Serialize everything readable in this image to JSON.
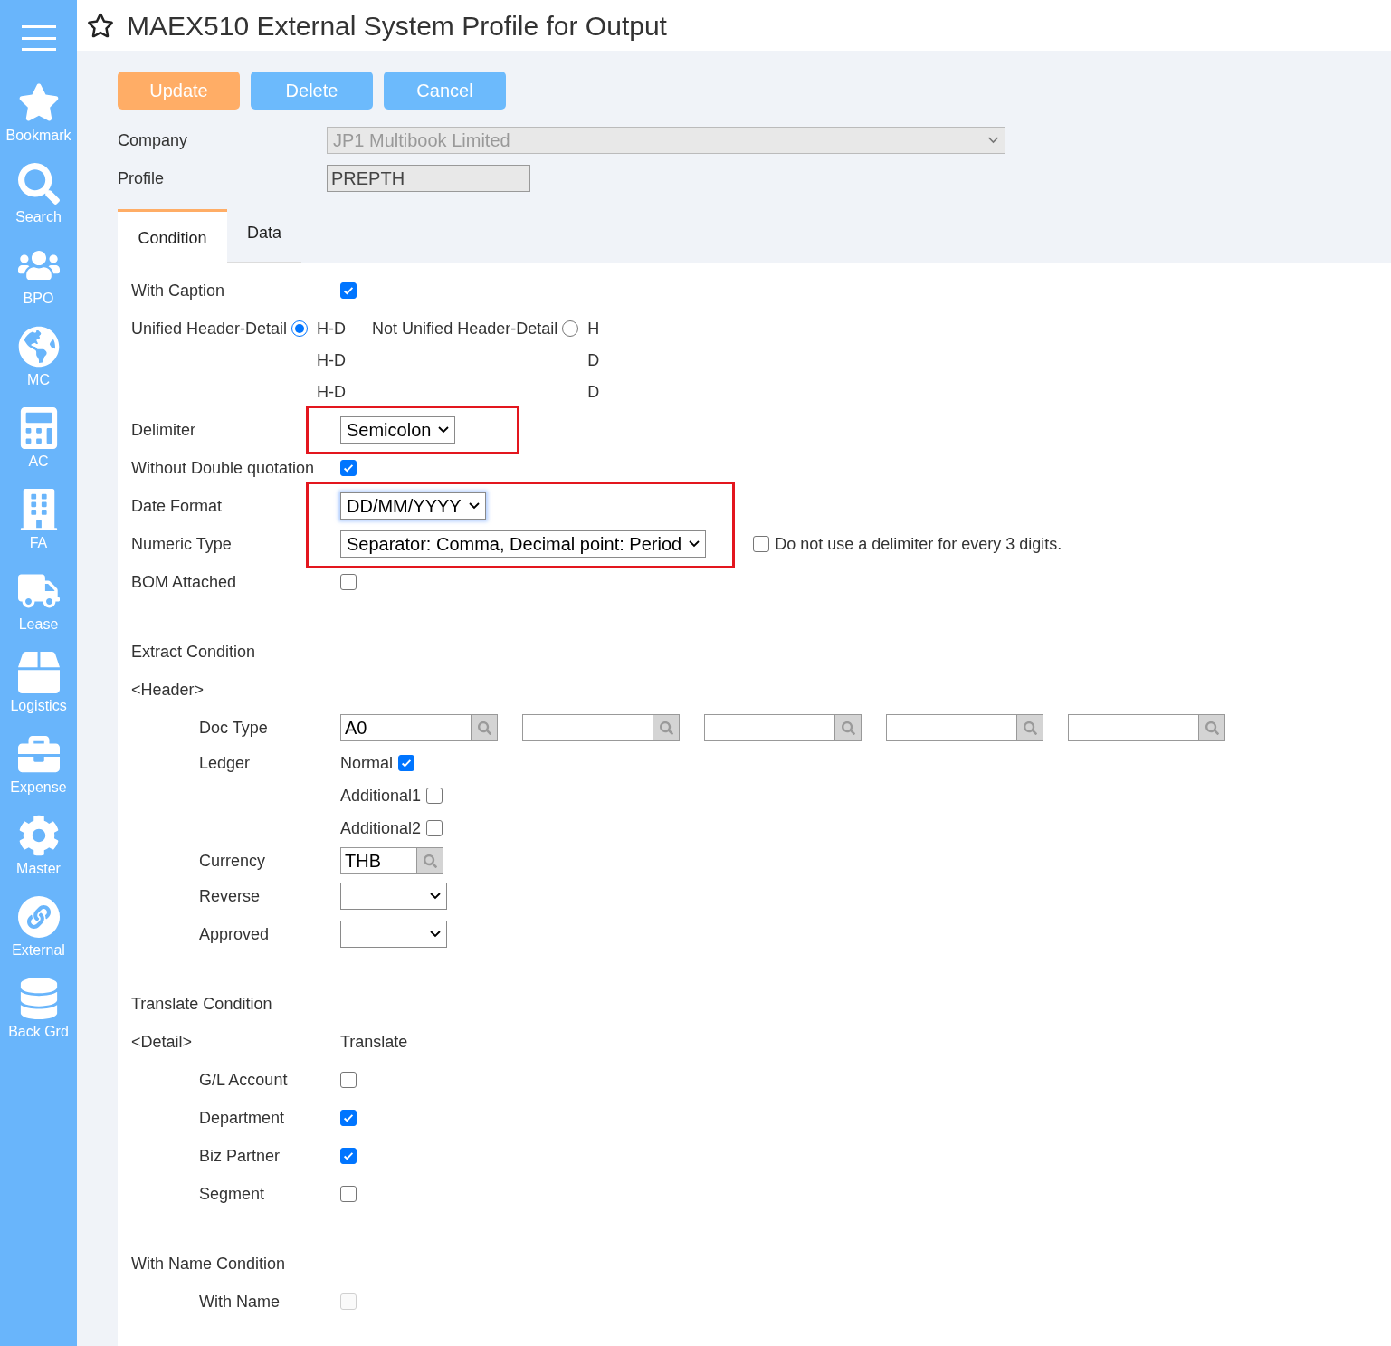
{
  "sidebar": {
    "items": [
      {
        "label": "Bookmark"
      },
      {
        "label": "Search"
      },
      {
        "label": "BPO"
      },
      {
        "label": "MC"
      },
      {
        "label": "AC"
      },
      {
        "label": "FA"
      },
      {
        "label": "Lease"
      },
      {
        "label": "Logistics"
      },
      {
        "label": "Expense"
      },
      {
        "label": "Master"
      },
      {
        "label": "External"
      },
      {
        "label": "Back Grd"
      }
    ]
  },
  "header": {
    "title": "MAEX510 External System Profile for Output"
  },
  "toolbar": {
    "buttons": [
      {
        "label": "Update",
        "kind": "primary"
      },
      {
        "label": "Delete",
        "kind": "secondary"
      },
      {
        "label": "Cancel",
        "kind": "secondary"
      }
    ]
  },
  "company": {
    "label": "Company",
    "value": "JP1 Multibook Limited"
  },
  "profile": {
    "label": "Profile",
    "value": "PREPTH"
  },
  "tabs": [
    {
      "label": "Condition",
      "selected": true
    },
    {
      "label": "Data",
      "selected": false
    }
  ],
  "condition_rows": [
    {
      "kind": "checkbox",
      "label": "With Caption",
      "checked": true
    },
    {
      "kind": "radio",
      "options": [
        {
          "label": "Unified Header-Detail",
          "selected": true,
          "lines": [
            "H-D",
            "H-D",
            "H-D"
          ]
        },
        {
          "label": "Not Unified Header-Detail",
          "selected": false,
          "lines": [
            "H",
            "D",
            "D"
          ]
        }
      ]
    },
    {
      "kind": "select",
      "label": "Delimiter",
      "value": "Semicolon",
      "highlighted": true
    },
    {
      "kind": "checkbox",
      "label": "Without Double quotation",
      "checked": true
    },
    {
      "kind": "select",
      "label": "Date Format",
      "value": "DD/MM/YYYY",
      "highlighted": true,
      "focused": true
    },
    {
      "kind": "select",
      "label": "Numeric Type",
      "value": "Separator: Comma, Decimal point: Period",
      "highlighted": true,
      "extra": {
        "label": "Do not use a delimiter for every 3 digits.",
        "checked": false
      }
    },
    {
      "kind": "checkbox",
      "label": "BOM Attached",
      "checked": false
    }
  ],
  "extract": {
    "title": "Extract Condition",
    "subtitle": "<Header>",
    "rows": [
      {
        "kind": "lookups",
        "label": "Doc Type",
        "fields": [
          {
            "kind": "filled",
            "value": "A0"
          },
          {
            "kind": "blank"
          },
          {
            "kind": "blank"
          },
          {
            "kind": "blank"
          },
          {
            "kind": "blank"
          }
        ]
      },
      {
        "kind": "checklist",
        "label": "Ledger",
        "items": [
          {
            "label": "Normal",
            "checked": true
          },
          {
            "label": "Additional1",
            "checked": false
          },
          {
            "label": "Additional2",
            "checked": false
          }
        ]
      },
      {
        "kind": "lookup",
        "label": "Currency",
        "value": "THB"
      },
      {
        "kind": "select",
        "label": "Reverse"
      },
      {
        "kind": "select",
        "label": "Approved"
      }
    ]
  },
  "translate": {
    "title": "Translate Condition",
    "subtitle": "<Detail>",
    "column_heading": "Translate",
    "rows": [
      {
        "kind": "checkbox",
        "label": "G/L Account",
        "checked": false
      },
      {
        "kind": "checkbox",
        "label": "Department",
        "checked": true
      },
      {
        "kind": "checkbox",
        "label": "Biz Partner",
        "checked": true
      },
      {
        "kind": "checkbox",
        "label": "Segment",
        "checked": false
      }
    ]
  },
  "with_name": {
    "title": "With Name Condition",
    "rows": [
      {
        "kind": "checkbox",
        "label": "With Name",
        "checked": false,
        "disabled": true
      }
    ]
  }
}
